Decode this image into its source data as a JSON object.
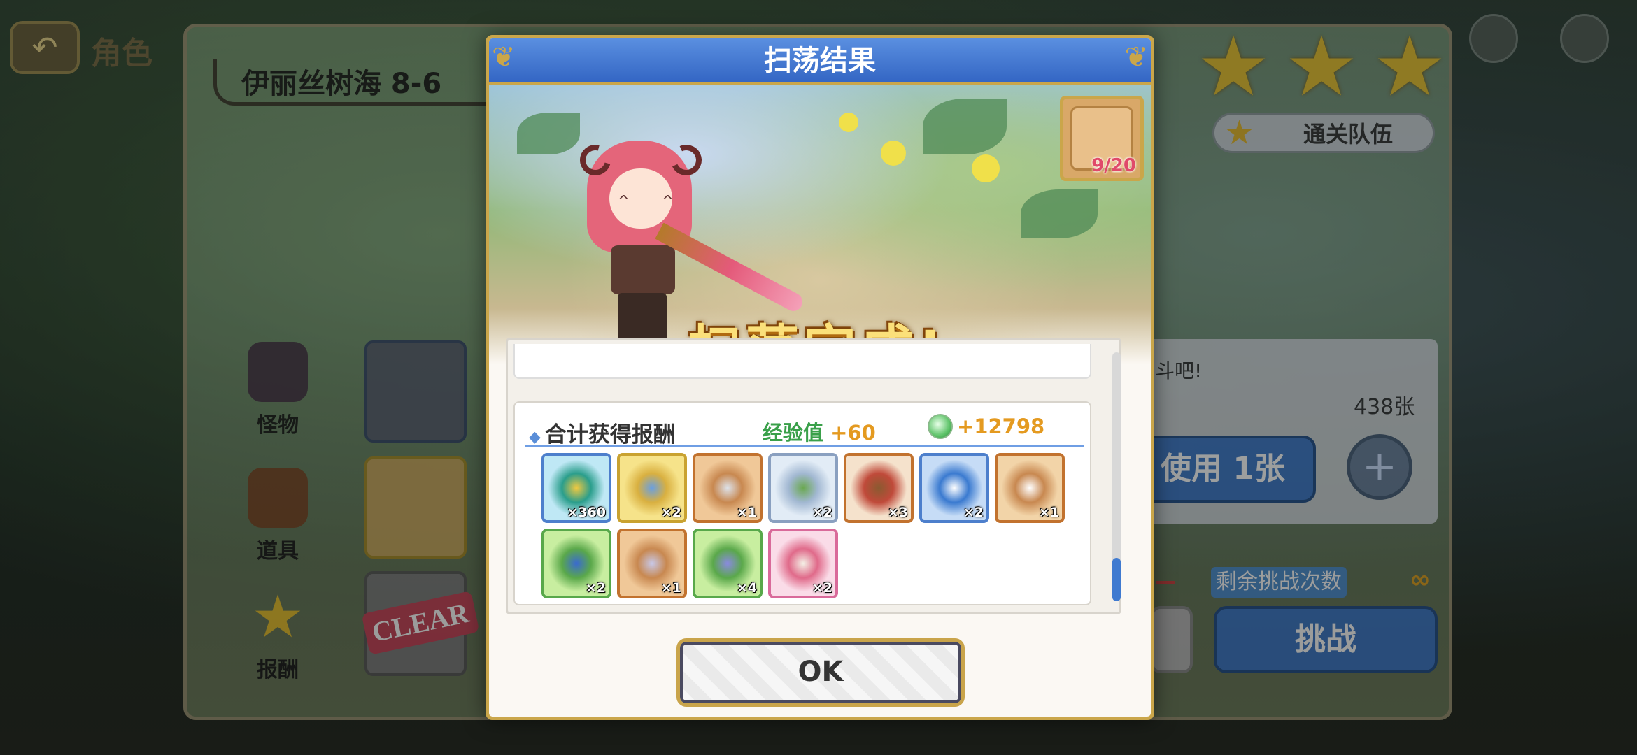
{
  "background": {
    "top_title": "角色",
    "back_icon": "back-arrow-icon",
    "quest": {
      "title": "伊丽丝树海 8-6",
      "tabs": [
        {
          "label": "怪物",
          "icon": "monster-icon"
        },
        {
          "label": "道具",
          "icon": "chest-icon"
        },
        {
          "label": "报酬",
          "icon": "star-icon"
        }
      ],
      "clear_stamp": "CLEAR",
      "team_button": "通关队伍",
      "info_text": "斗吧!",
      "ticket_count": "438张",
      "use_button": "使用 1张",
      "plus_button": "+",
      "remaining_label": "剩余挑战次数",
      "remaining_value": "∞",
      "challenge_button": "挑战",
      "stars": 3
    }
  },
  "modal": {
    "title": "扫荡结果",
    "complete_text": "扫荡完成!",
    "item_badge_count": "9/20",
    "rewards": {
      "header": "合计获得报酬",
      "exp_label": "经验值",
      "exp_value": "+60",
      "mana_value": "+12798",
      "items": [
        {
          "name": "green-pouch-item",
          "qty": "×360",
          "rarity": "blue",
          "colors": [
            "#bfe8f5",
            "#2a9e8c",
            "#f2c940"
          ]
        },
        {
          "name": "golden-feather-item",
          "qty": "×2",
          "rarity": "gold",
          "colors": [
            "#f6e38a",
            "#d9b040",
            "#6a9fe0"
          ]
        },
        {
          "name": "helmet-fragment-item",
          "qty": "×1",
          "rarity": "copper",
          "colors": [
            "#f0c898",
            "#c88850",
            "#dde2ea"
          ]
        },
        {
          "name": "silver-crest-item",
          "qty": "×2",
          "rarity": "silver",
          "colors": [
            "#e2ecf6",
            "#a2b8d2",
            "#6aa850"
          ]
        },
        {
          "name": "ruby-staff-item",
          "qty": "×3",
          "rarity": "copper",
          "colors": [
            "#f5e2cc",
            "#c04a3a",
            "#8a5a30"
          ]
        },
        {
          "name": "blue-ticket-item",
          "qty": "×2",
          "rarity": "blue",
          "colors": [
            "#c6dcf6",
            "#3a7ad0",
            "#ffffff"
          ]
        },
        {
          "name": "pearl-ornament-item",
          "qty": "×1",
          "rarity": "copper",
          "colors": [
            "#f2d4a8",
            "#c88850",
            "#ffffff"
          ]
        },
        {
          "name": "blue-potion-item",
          "qty": "×2",
          "rarity": "green",
          "colors": [
            "#c8eea0",
            "#5aa84a",
            "#3a6ad0"
          ]
        },
        {
          "name": "silver-band-fragment-item",
          "qty": "×1",
          "rarity": "copper",
          "colors": [
            "#f0c898",
            "#c88850",
            "#c8c8e8"
          ]
        },
        {
          "name": "elixir-flask-item",
          "qty": "×4",
          "rarity": "green",
          "colors": [
            "#c8eea0",
            "#5aa84a",
            "#8a8ae0"
          ]
        },
        {
          "name": "strawberry-cake-item",
          "qty": "×2",
          "rarity": "pink",
          "colors": [
            "#fadce8",
            "#e06a8a",
            "#f4f0e6"
          ]
        }
      ]
    },
    "ok_button": "OK"
  }
}
